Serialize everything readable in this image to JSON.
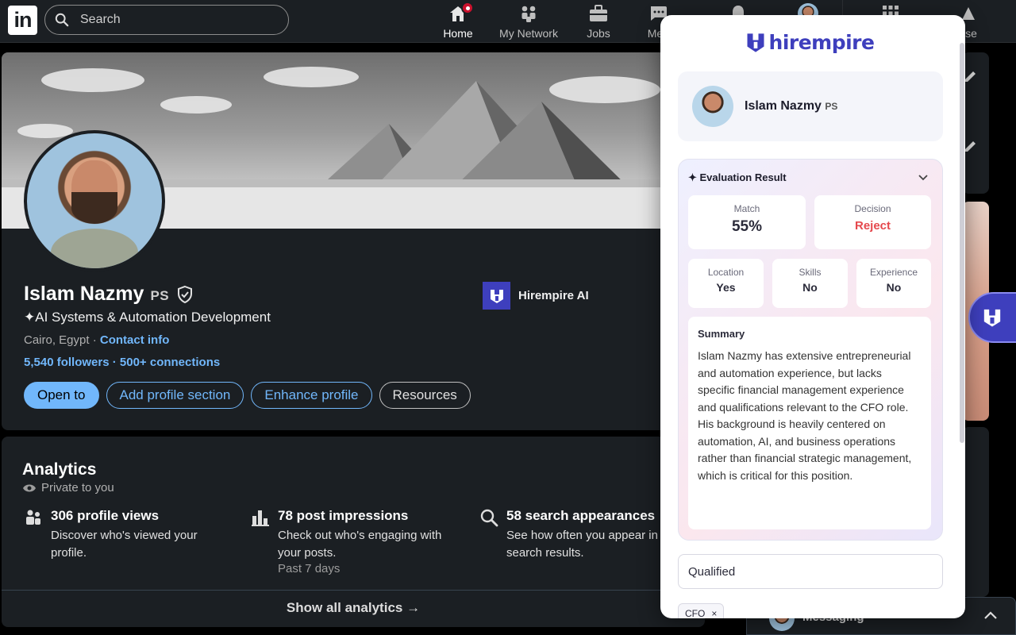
{
  "nav": {
    "logo": "in",
    "search_placeholder": "Search",
    "items": [
      {
        "label": "Home",
        "icon": "home-icon"
      },
      {
        "label": "My Network",
        "icon": "network-icon"
      },
      {
        "label": "Jobs",
        "icon": "briefcase-icon"
      },
      {
        "label": "Mes",
        "icon": "messaging-icon"
      },
      {
        "label": "",
        "icon": "bell-icon"
      },
      {
        "label": "",
        "icon": "avatar-icon"
      },
      {
        "label": "",
        "icon": "grid-icon"
      },
      {
        "label": "tise",
        "icon": "advertise-icon"
      }
    ]
  },
  "profile": {
    "name": "Islam Nazmy",
    "pronoun_badge": "PS",
    "headline": "✦AI Systems & Automation Development",
    "location": "Cairo, Egypt",
    "separator": " · ",
    "contact_label": "Contact info",
    "followers": "5,540 followers",
    "connections": "· 500+ connections",
    "buttons": {
      "open_to": "Open to",
      "add_section": "Add profile section",
      "enhance": "Enhance profile",
      "resources": "Resources"
    },
    "company": "Hirempire AI"
  },
  "analytics": {
    "title": "Analytics",
    "privacy": "Private to you",
    "items": [
      {
        "headline": "306 profile views",
        "desc": "Discover who's viewed your profile.",
        "sub": ""
      },
      {
        "headline": "78 post impressions",
        "desc": "Check out who's engaging with your posts.",
        "sub": "Past 7 days"
      },
      {
        "headline": "58 search appearances",
        "desc": "See how often you appear in search results.",
        "sub": ""
      }
    ],
    "show_all": "Show all analytics →"
  },
  "extension": {
    "brand": "hirempire",
    "candidate_name": "Islam Nazmy",
    "candidate_badge": "PS",
    "eval_title": "✦ Evaluation Result",
    "match_label": "Match",
    "match_value": "55%",
    "decision_label": "Decision",
    "decision_value": "Reject",
    "location_label": "Location",
    "location_value": "Yes",
    "skills_label": "Skills",
    "skills_value": "No",
    "experience_label": "Experience",
    "experience_value": "No",
    "summary_title": "Summary",
    "summary_text": "Islam Nazmy has extensive entrepreneurial and automation experience, but lacks specific financial management experience and qualifications relevant to the CFO role. His background is heavily centered on automation, AI, and business operations rather than financial strategic management, which is critical for this position.",
    "status_value": "Qualified",
    "tag": "CFO",
    "tag_remove": "×"
  },
  "messaging": {
    "label": "Messaging"
  },
  "colors": {
    "linkedin_bg": "#000000",
    "card_bg": "#1b1f23",
    "link_blue": "#71b7fb",
    "brand_indigo": "#3e3fbd",
    "reject_red": "#e5484d"
  }
}
